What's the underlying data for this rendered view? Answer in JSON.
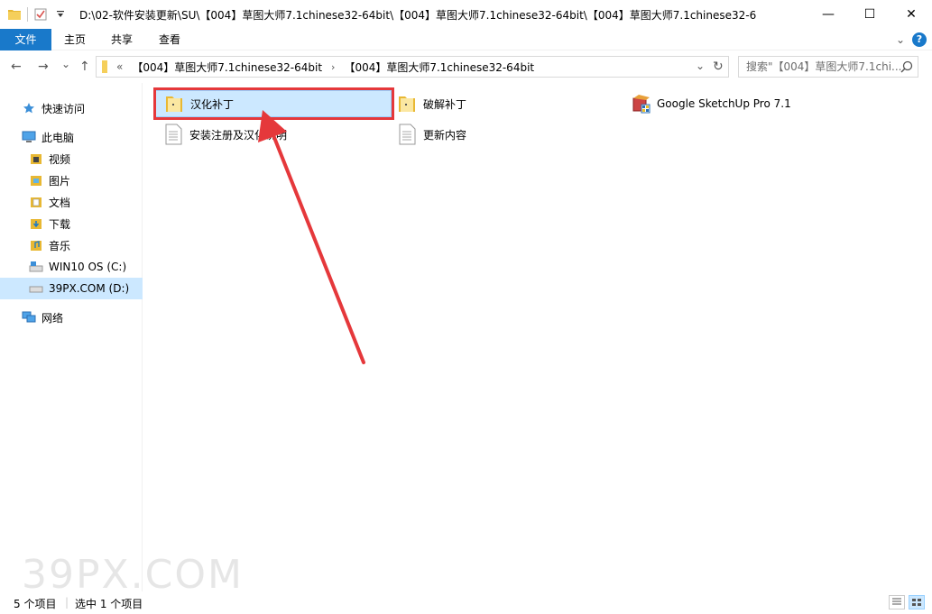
{
  "window": {
    "title_path": "D:\\02-软件安装更新\\SU\\【004】草图大师7.1chinese32-64bit\\【004】草图大师7.1chinese32-64bit\\【004】草图大师7.1chinese32-6",
    "minimize_glyph": "—",
    "maximize_glyph": "☐",
    "close_glyph": "✕"
  },
  "ribbon": {
    "tabs": [
      "文件",
      "主页",
      "共享",
      "查看"
    ],
    "help_glyph": "?"
  },
  "address": {
    "back_glyph": "←",
    "forward_glyph": "→",
    "recent_glyph": "⌄",
    "up_glyph": "↑",
    "overflow": "«",
    "crumbs": [
      "【004】草图大师7.1chinese32-64bit",
      "【004】草图大师7.1chinese32-64bit"
    ],
    "crumb_sep": "›",
    "dropdown_glyph": "⌄",
    "refresh_glyph": "↻",
    "search_placeholder": "搜索\"【004】草图大师7.1chi..."
  },
  "sidebar": {
    "items": [
      {
        "label": "快速访问",
        "icon": "star-icon"
      },
      {
        "label": "此电脑",
        "icon": "computer-icon"
      },
      {
        "label": "视频",
        "icon": "video-folder-icon"
      },
      {
        "label": "图片",
        "icon": "pictures-folder-icon"
      },
      {
        "label": "文档",
        "icon": "documents-folder-icon"
      },
      {
        "label": "下载",
        "icon": "downloads-folder-icon"
      },
      {
        "label": "音乐",
        "icon": "music-folder-icon"
      },
      {
        "label": "WIN10 OS (C:)",
        "icon": "system-drive-icon"
      },
      {
        "label": "39PX.COM (D:)",
        "icon": "drive-icon"
      },
      {
        "label": "网络",
        "icon": "network-icon"
      }
    ]
  },
  "files": [
    {
      "name": "汉化补丁",
      "type": "folder",
      "selected": true
    },
    {
      "name": "破解补丁",
      "type": "folder",
      "selected": false
    },
    {
      "name": "Google SketchUp Pro 7.1",
      "type": "installer",
      "selected": false
    },
    {
      "name": "安装注册及汉化说明",
      "type": "text",
      "selected": false
    },
    {
      "name": "更新内容",
      "type": "text",
      "selected": false
    }
  ],
  "status": {
    "item_count": "5 个项目",
    "selected_count": "选中 1 个项目"
  },
  "watermark": "39PX.COM",
  "colors": {
    "accent": "#1979ca",
    "selection": "#cce8ff",
    "highlight_red": "#e5383b"
  }
}
